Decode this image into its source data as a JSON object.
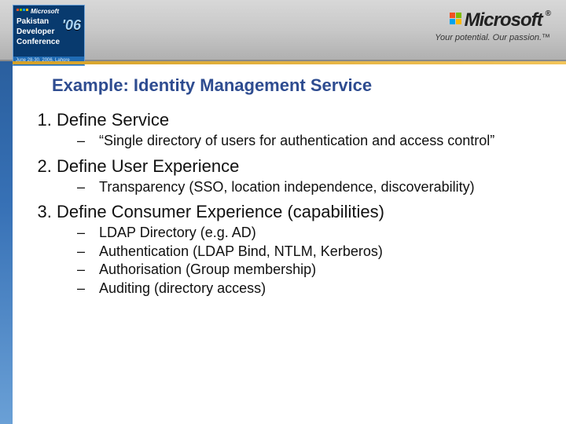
{
  "header": {
    "badge": {
      "brand": "Microsoft",
      "conference_line1": "Pakistan",
      "conference_line2": "Developer",
      "conference_line3": "Conference",
      "year": "'06",
      "footer": "June 28-30, 2006, Lahore"
    },
    "brand": {
      "name": "Microsoft",
      "registered": "®",
      "tagline": "Your potential. Our passion.™"
    }
  },
  "slide": {
    "title": "Example: Identity Management Service",
    "items": [
      {
        "title": "Define Service",
        "sub": [
          "“Single directory of users for authentication and access control”"
        ]
      },
      {
        "title": "Define User Experience",
        "sub": [
          "Transparency (SSO, location independence, discoverability)"
        ]
      },
      {
        "title": "Define Consumer Experience (capabilities)",
        "sub": [
          "LDAP Directory (e.g. AD)",
          "Authentication (LDAP Bind, NTLM, Kerberos)",
          "Authorisation (Group membership)",
          "Auditing (directory access)"
        ]
      }
    ]
  }
}
